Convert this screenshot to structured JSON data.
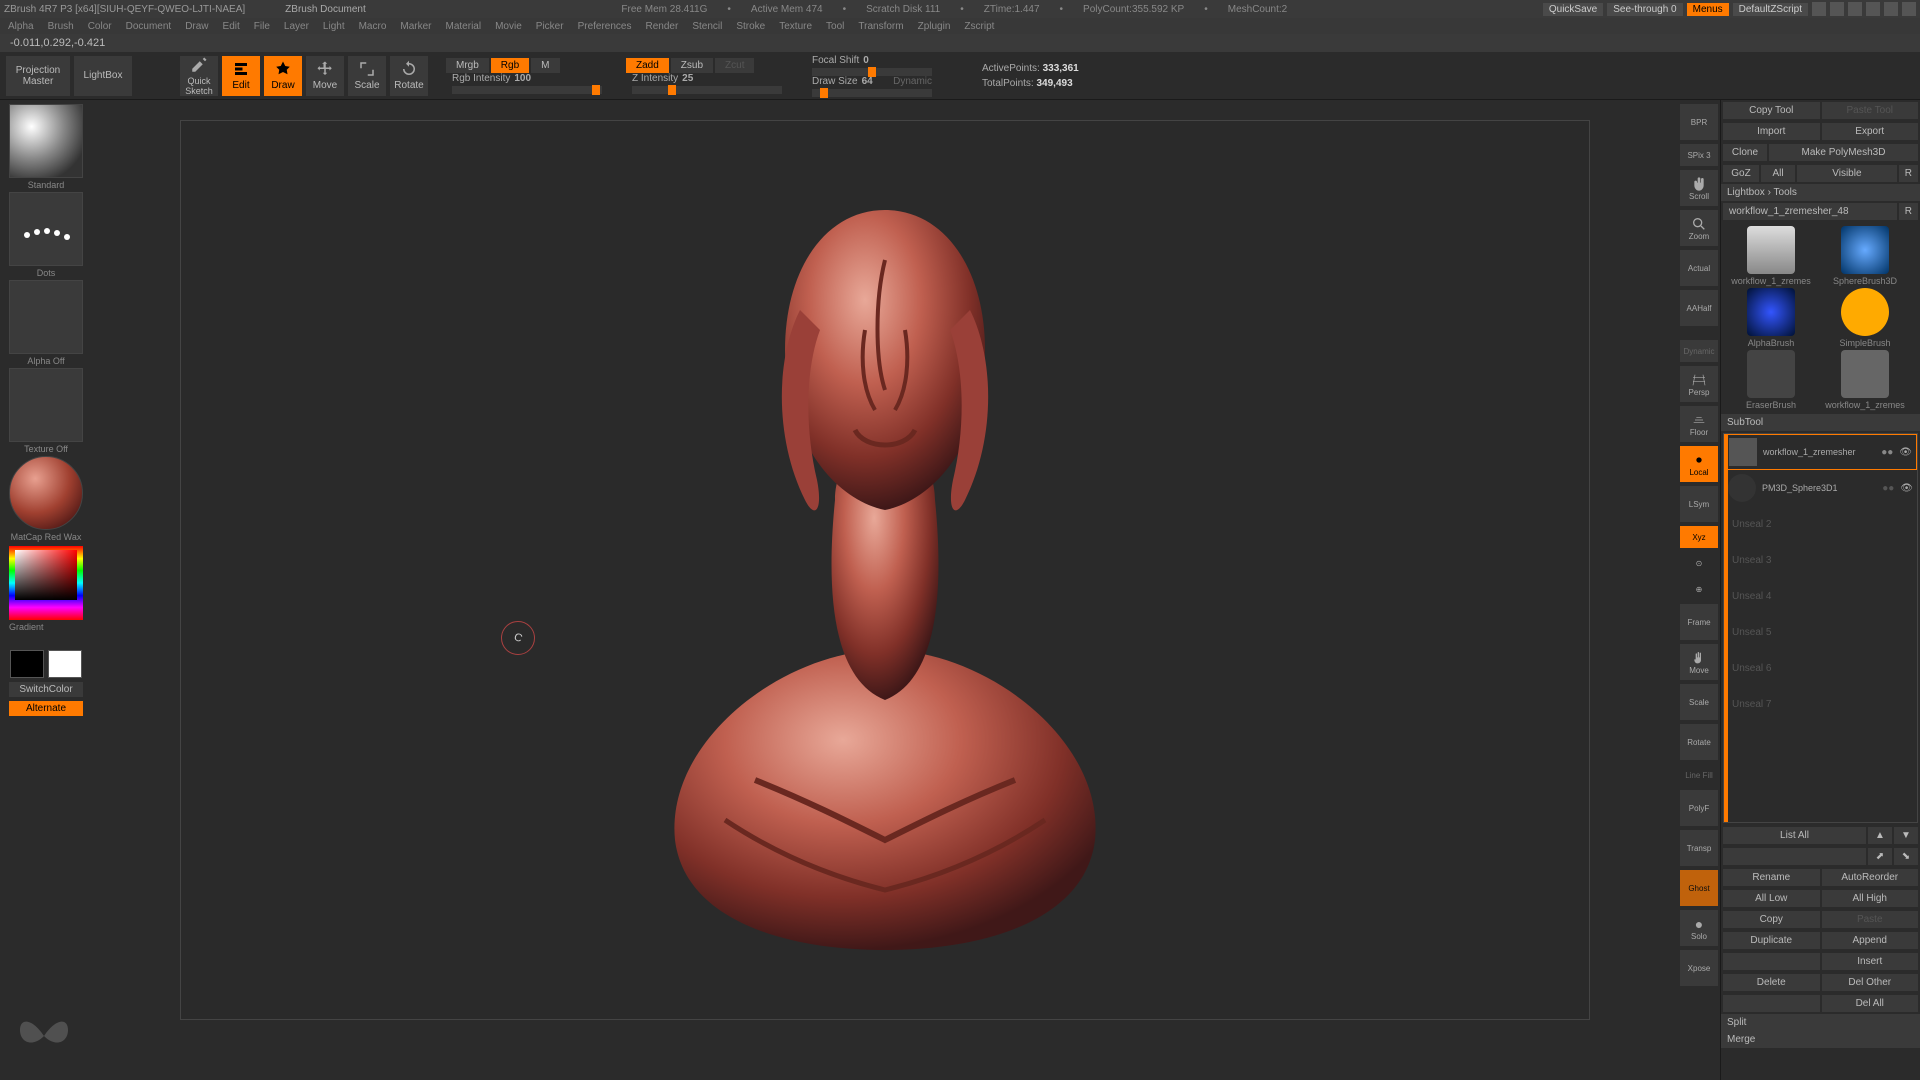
{
  "titlebar": {
    "app": "ZBrush 4R7 P3 [x64][SIUH-QEYF-QWEO-LJTI-NAEA]",
    "doc": "ZBrush Document",
    "stats": {
      "freemem": "Free Mem 28.411G",
      "activemem": "Active Mem 474",
      "scratch": "Scratch Disk 111",
      "ztime": "ZTime:1.447",
      "polycount": "PolyCount:355.592 KP",
      "meshcount": "MeshCount:2"
    },
    "quicksave": "QuickSave",
    "seethrough": "See-through  0",
    "menus": "Menus",
    "defaultscript": "DefaultZScript"
  },
  "menubar": [
    "Alpha",
    "Brush",
    "Color",
    "Document",
    "Draw",
    "Edit",
    "File",
    "Layer",
    "Light",
    "Macro",
    "Marker",
    "Material",
    "Movie",
    "Picker",
    "Preferences",
    "Render",
    "Stencil",
    "Stroke",
    "Texture",
    "Tool",
    "Transform",
    "Zplugin",
    "Zscript"
  ],
  "coord": "-0.011,0.292,-0.421",
  "shelf": {
    "projection": "Projection\nMaster",
    "lightbox": "LightBox",
    "quicksketch": "Quick\nSketch",
    "edit": "Edit",
    "draw": "Draw",
    "move": "Move",
    "scale": "Scale",
    "rotate": "Rotate",
    "mrgb": "Mrgb",
    "rgb": "Rgb",
    "m": "M",
    "rgbintensity_lbl": "Rgb Intensity",
    "rgbintensity_val": "100",
    "zadd": "Zadd",
    "zsub": "Zsub",
    "zcut": "Zcut",
    "zintensity_lbl": "Z Intensity",
    "zintensity_val": "25",
    "focalshift_lbl": "Focal Shift",
    "focalshift_val": "0",
    "drawsize_lbl": "Draw Size",
    "drawsize_val": "64",
    "dynamic": "Dynamic",
    "activepoints_lbl": "ActivePoints:",
    "activepoints_val": "333,361",
    "totalpoints_lbl": "TotalPoints:",
    "totalpoints_val": "349,493"
  },
  "lefttray": {
    "brush": "Standard",
    "stroke": "Dots",
    "alpha": "Alpha  Off",
    "texture": "Texture  Off",
    "material": "MatCap Red Wax",
    "gradient": "Gradient",
    "switchcolor": "SwitchColor",
    "alternate": "Alternate"
  },
  "rtools": {
    "bpr": "BPR",
    "spix": "SPix 3",
    "scroll": "Scroll",
    "zoom": "Zoom",
    "actual": "Actual",
    "aahalf": "AAHalf",
    "persp": "Persp",
    "floor": "Floor",
    "local": "Local",
    "lsym": "LSym",
    "xyz": "Xyz",
    "frame": "Frame",
    "move": "Move",
    "scale": "Scale",
    "rotate": "Rotate",
    "linefill": "Line Fill",
    "polyf": "PolyF",
    "transp": "Transp",
    "ghost": "Ghost",
    "solo": "Solo",
    "xpose": "Xpose",
    "dynamic": "Dynamic"
  },
  "rpanel": {
    "copytool": "Copy Tool",
    "pastetool": "Paste Tool",
    "import": "Import",
    "export": "Export",
    "clone": "Clone",
    "makepoly": "Make PolyMesh3D",
    "goz": "GoZ",
    "all": "All",
    "visible": "Visible",
    "r": "R",
    "lightboxtools": "Lightbox › Tools",
    "toolname": "workflow_1_zremesher_48",
    "tools": [
      {
        "name": "workflow_1_zremes"
      },
      {
        "name": "SphereBrush3D"
      },
      {
        "name": "AlphaBrush"
      },
      {
        "name": "SimpleBrush"
      },
      {
        "name": "EraserBrush"
      },
      {
        "name": "workflow_1_zremes"
      }
    ],
    "subtool_hdr": "SubTool",
    "subtools": [
      {
        "name": "workflow_1_zremesher",
        "active": true
      },
      {
        "name": "PM3D_Sphere3D1",
        "active": false
      }
    ],
    "slots": [
      "Unseal 2",
      "Unseal 3",
      "Unseal 4",
      "Unseal 5",
      "Unseal 6",
      "Unseal 7"
    ],
    "listall": "List All",
    "rename": "Rename",
    "autoreorder": "AutoReorder",
    "alllow": "All Low",
    "allhigh": "All High",
    "copy": "Copy",
    "paste": "Paste",
    "duplicate": "Duplicate",
    "append": "Append",
    "insert": "Insert",
    "delete": "Delete",
    "delother": "Del Other",
    "delall": "Del All",
    "split": "Split",
    "merge": "Merge"
  }
}
